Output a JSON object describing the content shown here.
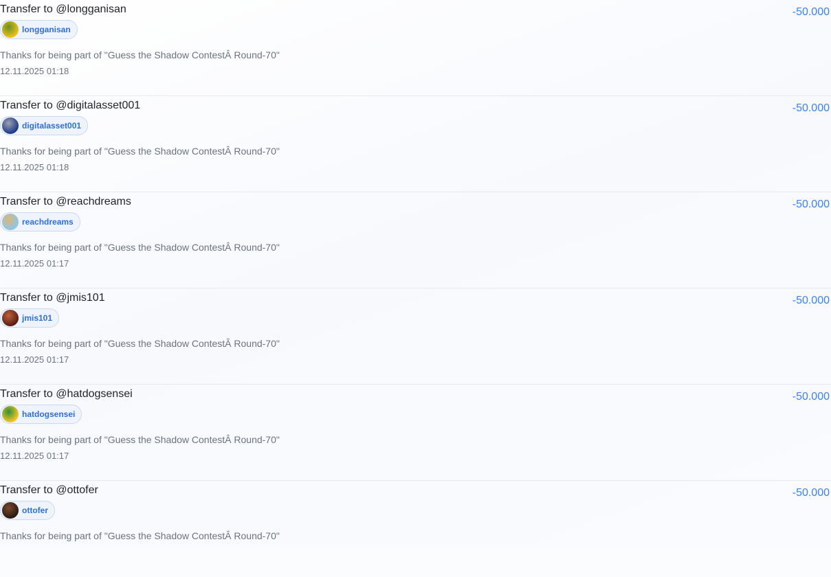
{
  "transfers": [
    {
      "title": "Transfer to @longganisan",
      "user": "longganisan",
      "avatar_icon": "user-avatar-longganisan",
      "avatar_colors": [
        "#e9c21a",
        "#6b8f23"
      ],
      "memo": "Thanks for being part of \"Guess the Shadow ContestÂ Round-70\"",
      "date": "12.11.2025 01:18",
      "amount": "-50.000"
    },
    {
      "title": "Transfer to @digitalasset001",
      "user": "digitalasset001",
      "avatar_icon": "user-avatar-digitalasset001",
      "avatar_colors": [
        "#1e3a8a",
        "#9ca3af"
      ],
      "memo": "Thanks for being part of \"Guess the Shadow ContestÂ Round-70\"",
      "date": "12.11.2025 01:18",
      "amount": "-50.000"
    },
    {
      "title": "Transfer to @reachdreams",
      "user": "reachdreams",
      "avatar_icon": "user-avatar-reachdreams",
      "avatar_colors": [
        "#8ec5e8",
        "#d9b878"
      ],
      "memo": "Thanks for being part of \"Guess the Shadow ContestÂ Round-70\"",
      "date": "12.11.2025 01:17",
      "amount": "-50.000"
    },
    {
      "title": "Transfer to @jmis101",
      "user": "jmis101",
      "avatar_icon": "user-avatar-jmis101",
      "avatar_colors": [
        "#5a1e14",
        "#c0603c"
      ],
      "memo": "Thanks for being part of \"Guess the Shadow ContestÂ Round-70\"",
      "date": "12.11.2025 01:17",
      "amount": "-50.000"
    },
    {
      "title": "Transfer to @hatdogsensei",
      "user": "hatdogsensei",
      "avatar_icon": "user-avatar-hatdogsensei",
      "avatar_colors": [
        "#f3c623",
        "#2f8f3a"
      ],
      "memo": "Thanks for being part of \"Guess the Shadow ContestÂ Round-70\"",
      "date": "12.11.2025 01:17",
      "amount": "-50.000"
    },
    {
      "title": "Transfer to @ottofer",
      "user": "ottofer",
      "avatar_icon": "user-avatar-ottofer",
      "avatar_colors": [
        "#2b1a12",
        "#7a4a30"
      ],
      "memo": "Thanks for being part of \"Guess the Shadow ContestÂ Round-70\"",
      "date": "",
      "amount": "-50.000"
    }
  ]
}
